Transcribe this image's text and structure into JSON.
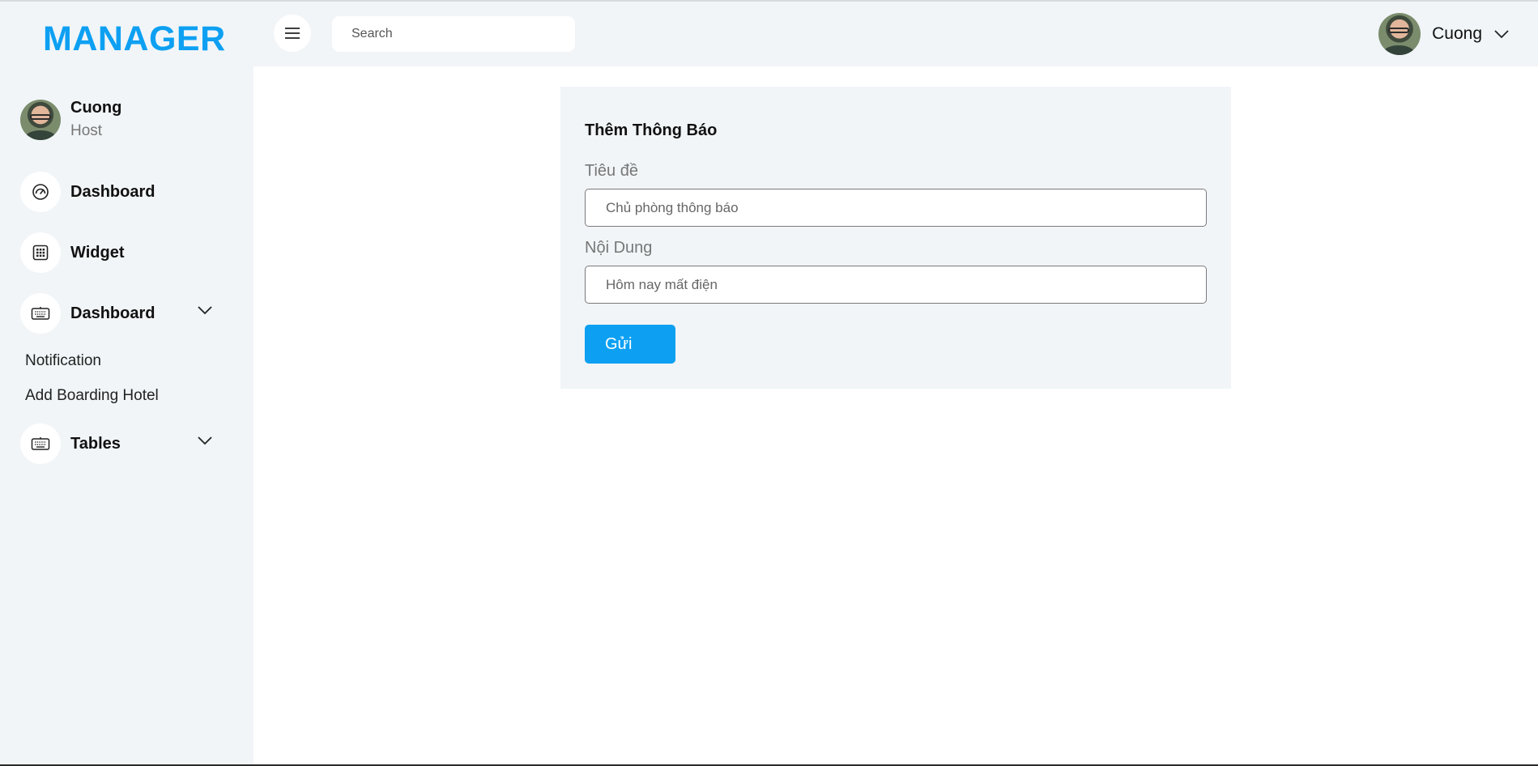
{
  "app": {
    "brand": "MANAGER",
    "colors": {
      "accent": "#0da0f2",
      "sidebar_bg": "#f1f5f8",
      "text": "#111111"
    }
  },
  "header": {
    "search_placeholder": "Search",
    "user_name": "Cuong"
  },
  "sidebar": {
    "profile": {
      "name": "Cuong",
      "role": "Host"
    },
    "items": [
      {
        "label": "Dashboard",
        "icon": "speedometer-icon"
      },
      {
        "label": "Widget",
        "icon": "grid-icon"
      },
      {
        "label": "Dashboard",
        "icon": "keyboard-icon",
        "expanded": true,
        "children": [
          "Notification",
          "Add Boarding Hotel"
        ]
      },
      {
        "label": "Tables",
        "icon": "keyboard-icon",
        "expanded": false
      }
    ]
  },
  "form": {
    "title": "Thêm Thông Báo",
    "title_label": "Tiêu đề",
    "title_placeholder": "Chủ phòng thông báo",
    "content_label": "Nội Dung",
    "content_placeholder": "Hôm nay mất điện",
    "submit_label": "Gửi"
  }
}
